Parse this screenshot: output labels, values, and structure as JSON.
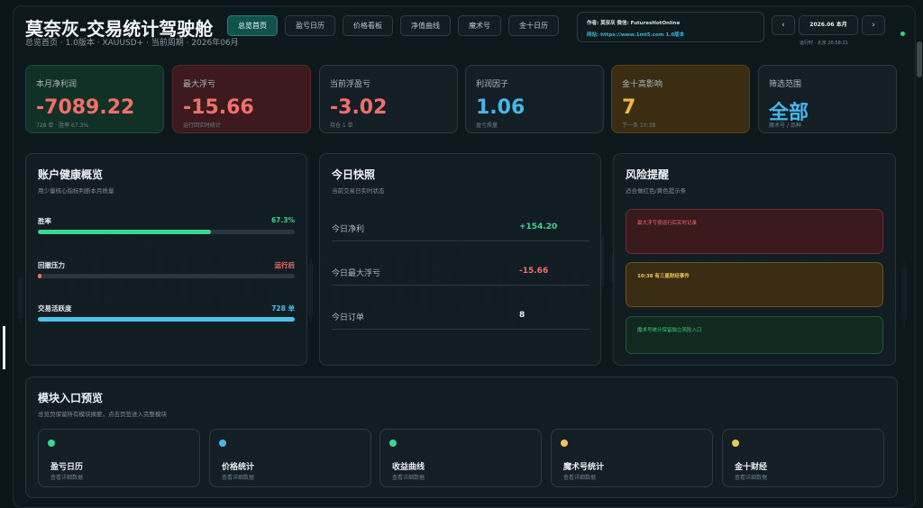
{
  "header": {
    "title": "莫奈灰-交易统计驾驶舱",
    "subtitle": "总览首页 · 1.0版本 · XAUUSD+ · 当前周期 · 2026年06月"
  },
  "nav": {
    "tabs": [
      {
        "label": "总览首页",
        "active": true
      },
      {
        "label": "盈亏日历",
        "active": false
      },
      {
        "label": "价格看板",
        "active": false
      },
      {
        "label": "净值曲线",
        "active": false
      },
      {
        "label": "魔术号",
        "active": false
      },
      {
        "label": "金十日历",
        "active": false
      }
    ]
  },
  "info": {
    "line1": "作者: 莫奈灰   微信: FuturesHotOnline",
    "line2": "网站: https://www.1mt5.com   1.0版本"
  },
  "pager": {
    "prev_icon": "‹",
    "month": "2026.06 本月",
    "next_icon": "›",
    "status": "运行时 · 北京 20:58:21"
  },
  "kpis": [
    {
      "label": "本月净利润",
      "value": "-7089.22",
      "sub": "728 单 · 胜率 67.3%",
      "tone": "green",
      "value_color": "#f26f6b"
    },
    {
      "label": "最大浮亏",
      "value": "-15.66",
      "sub": "运行回实时统计",
      "tone": "red",
      "value_color": "#f26f6b"
    },
    {
      "label": "当前浮盈亏",
      "value": "-3.02",
      "sub": "持仓 1 单",
      "tone": "dark",
      "value_color": "#f26f6b"
    },
    {
      "label": "利润因子",
      "value": "1.06",
      "sub": "盈亏质量",
      "tone": "dark",
      "value_color": "#46b7ea"
    },
    {
      "label": "金十高影响",
      "value": "7",
      "sub": "下一条 10:38",
      "tone": "gold",
      "value_color": "#f2b747"
    },
    {
      "label": "筛选范围",
      "value": "全部",
      "sub": "魔术号 / 品种",
      "tone": "dark",
      "value_color": "#46b7ea"
    }
  ],
  "health": {
    "title": "账户健康概览",
    "subtitle": "用少量核心指标判断本月质量",
    "bars": [
      {
        "label": "胜率",
        "value": "67.3%",
        "fraction": 0.673,
        "color": "#3bd68d"
      },
      {
        "label": "回撤压力",
        "value": "运行后",
        "fraction": 0.012,
        "color": "#f26f6b"
      },
      {
        "label": "交易活跃度",
        "value": "728 单",
        "fraction": 1.0,
        "color": "#46c3ea"
      }
    ]
  },
  "snapshot": {
    "title": "今日快照",
    "subtitle": "当前交易日实时状态",
    "rows": [
      {
        "label": "今日净利",
        "value": "+154.20",
        "color": "#3bd68d"
      },
      {
        "label": "今日最大浮亏",
        "value": "-15.66",
        "color": "#f26f6b"
      },
      {
        "label": "今日订单",
        "value": "8",
        "color": "#e8edef"
      }
    ]
  },
  "risk": {
    "title": "风险提醒",
    "subtitle": "适合做红色/黄色提示条",
    "alerts": [
      {
        "text": "最大浮亏按运行后实时记录",
        "tone": "red"
      },
      {
        "text": "10:38 有三星财经事件",
        "tone": "gold"
      },
      {
        "text": "魔术号统计保留独立风险入口",
        "tone": "green"
      }
    ]
  },
  "modules": {
    "title": "模块入口预览",
    "subtitle": "总览页保留所有模块摘要，点击页签进入完整模块",
    "items": [
      {
        "name": "盈亏日历",
        "sub": "查看详细数据",
        "dot": "#3bd68d"
      },
      {
        "name": "价格统计",
        "sub": "查看详细数据",
        "dot": "#46b7ea"
      },
      {
        "name": "收益曲线",
        "sub": "查看详细数据",
        "dot": "#3bd68d"
      },
      {
        "name": "魔术号统计",
        "sub": "查看详细数据",
        "dot": "#f2c45a"
      },
      {
        "name": "金十财经",
        "sub": "查看详细数据",
        "dot": "#f2c45a"
      }
    ]
  },
  "colors": {
    "background": "#0b1418",
    "accent_teal": "#12524d",
    "green": "#3bd68d",
    "red": "#f26f6b",
    "blue": "#46b7ea",
    "gold": "#f2b747"
  }
}
